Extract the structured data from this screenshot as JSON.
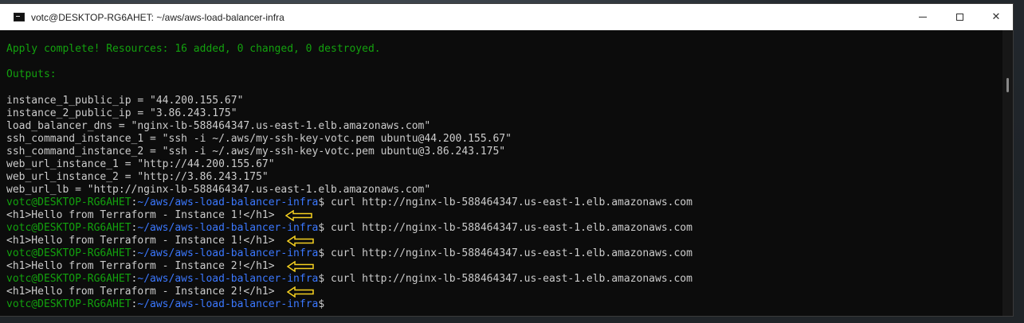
{
  "window": {
    "title": "votc@DESKTOP-RG6AHET: ~/aws/aws-load-balancer-infra",
    "icon": "terminal-icon"
  },
  "terminal": {
    "apply_line": "Apply complete! Resources: 16 added, 0 changed, 0 destroyed.",
    "outputs_label": "Outputs:",
    "outputs": [
      "instance_1_public_ip = \"44.200.155.67\"",
      "instance_2_public_ip = \"3.86.243.175\"",
      "load_balancer_dns = \"nginx-lb-588464347.us-east-1.elb.amazonaws.com\"",
      "ssh_command_instance_1 = \"ssh -i ~/.aws/my-ssh-key-votc.pem ubuntu@44.200.155.67\"",
      "ssh_command_instance_2 = \"ssh -i ~/.aws/my-ssh-key-votc.pem ubuntu@3.86.243.175\"",
      "web_url_instance_1 = \"http://44.200.155.67\"",
      "web_url_instance_2 = \"http://3.86.243.175\"",
      "web_url_lb = \"http://nginx-lb-588464347.us-east-1.elb.amazonaws.com\""
    ],
    "prompt_user": "votc@DESKTOP-RG6AHET",
    "prompt_sep": ":",
    "prompt_path": "~/aws/aws-load-balancer-infra",
    "prompt_end": "$",
    "command": " curl http://nginx-lb-588464347.us-east-1.elb.amazonaws.com",
    "responses": [
      "<h1>Hello from Terraform - Instance 1!</h1>",
      "<h1>Hello from Terraform - Instance 1!</h1>",
      "<h1>Hello from Terraform - Instance 2!</h1>",
      "<h1>Hello from Terraform - Instance 2!</h1>"
    ]
  },
  "colors": {
    "success_green": "#13a10e",
    "prompt_blue": "#3b78ff",
    "text_gray": "#cccccc",
    "annotation_arrow": "#f5d020"
  }
}
